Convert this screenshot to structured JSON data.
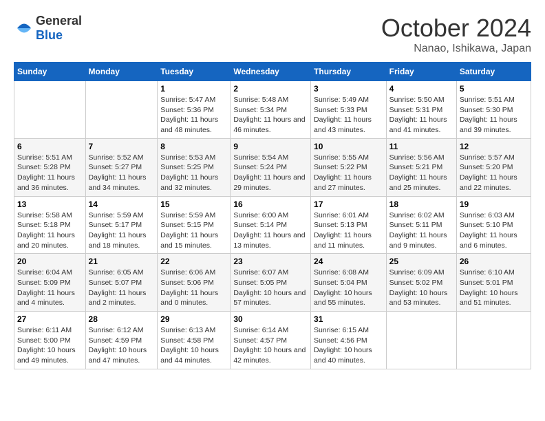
{
  "header": {
    "logo_general": "General",
    "logo_blue": "Blue",
    "month": "October 2024",
    "location": "Nanao, Ishikawa, Japan"
  },
  "columns": [
    "Sunday",
    "Monday",
    "Tuesday",
    "Wednesday",
    "Thursday",
    "Friday",
    "Saturday"
  ],
  "weeks": [
    [
      {
        "day": "",
        "sunrise": "",
        "sunset": "",
        "daylight": ""
      },
      {
        "day": "",
        "sunrise": "",
        "sunset": "",
        "daylight": ""
      },
      {
        "day": "1",
        "sunrise": "Sunrise: 5:47 AM",
        "sunset": "Sunset: 5:36 PM",
        "daylight": "Daylight: 11 hours and 48 minutes."
      },
      {
        "day": "2",
        "sunrise": "Sunrise: 5:48 AM",
        "sunset": "Sunset: 5:34 PM",
        "daylight": "Daylight: 11 hours and 46 minutes."
      },
      {
        "day": "3",
        "sunrise": "Sunrise: 5:49 AM",
        "sunset": "Sunset: 5:33 PM",
        "daylight": "Daylight: 11 hours and 43 minutes."
      },
      {
        "day": "4",
        "sunrise": "Sunrise: 5:50 AM",
        "sunset": "Sunset: 5:31 PM",
        "daylight": "Daylight: 11 hours and 41 minutes."
      },
      {
        "day": "5",
        "sunrise": "Sunrise: 5:51 AM",
        "sunset": "Sunset: 5:30 PM",
        "daylight": "Daylight: 11 hours and 39 minutes."
      }
    ],
    [
      {
        "day": "6",
        "sunrise": "Sunrise: 5:51 AM",
        "sunset": "Sunset: 5:28 PM",
        "daylight": "Daylight: 11 hours and 36 minutes."
      },
      {
        "day": "7",
        "sunrise": "Sunrise: 5:52 AM",
        "sunset": "Sunset: 5:27 PM",
        "daylight": "Daylight: 11 hours and 34 minutes."
      },
      {
        "day": "8",
        "sunrise": "Sunrise: 5:53 AM",
        "sunset": "Sunset: 5:25 PM",
        "daylight": "Daylight: 11 hours and 32 minutes."
      },
      {
        "day": "9",
        "sunrise": "Sunrise: 5:54 AM",
        "sunset": "Sunset: 5:24 PM",
        "daylight": "Daylight: 11 hours and 29 minutes."
      },
      {
        "day": "10",
        "sunrise": "Sunrise: 5:55 AM",
        "sunset": "Sunset: 5:22 PM",
        "daylight": "Daylight: 11 hours and 27 minutes."
      },
      {
        "day": "11",
        "sunrise": "Sunrise: 5:56 AM",
        "sunset": "Sunset: 5:21 PM",
        "daylight": "Daylight: 11 hours and 25 minutes."
      },
      {
        "day": "12",
        "sunrise": "Sunrise: 5:57 AM",
        "sunset": "Sunset: 5:20 PM",
        "daylight": "Daylight: 11 hours and 22 minutes."
      }
    ],
    [
      {
        "day": "13",
        "sunrise": "Sunrise: 5:58 AM",
        "sunset": "Sunset: 5:18 PM",
        "daylight": "Daylight: 11 hours and 20 minutes."
      },
      {
        "day": "14",
        "sunrise": "Sunrise: 5:59 AM",
        "sunset": "Sunset: 5:17 PM",
        "daylight": "Daylight: 11 hours and 18 minutes."
      },
      {
        "day": "15",
        "sunrise": "Sunrise: 5:59 AM",
        "sunset": "Sunset: 5:15 PM",
        "daylight": "Daylight: 11 hours and 15 minutes."
      },
      {
        "day": "16",
        "sunrise": "Sunrise: 6:00 AM",
        "sunset": "Sunset: 5:14 PM",
        "daylight": "Daylight: 11 hours and 13 minutes."
      },
      {
        "day": "17",
        "sunrise": "Sunrise: 6:01 AM",
        "sunset": "Sunset: 5:13 PM",
        "daylight": "Daylight: 11 hours and 11 minutes."
      },
      {
        "day": "18",
        "sunrise": "Sunrise: 6:02 AM",
        "sunset": "Sunset: 5:11 PM",
        "daylight": "Daylight: 11 hours and 9 minutes."
      },
      {
        "day": "19",
        "sunrise": "Sunrise: 6:03 AM",
        "sunset": "Sunset: 5:10 PM",
        "daylight": "Daylight: 11 hours and 6 minutes."
      }
    ],
    [
      {
        "day": "20",
        "sunrise": "Sunrise: 6:04 AM",
        "sunset": "Sunset: 5:09 PM",
        "daylight": "Daylight: 11 hours and 4 minutes."
      },
      {
        "day": "21",
        "sunrise": "Sunrise: 6:05 AM",
        "sunset": "Sunset: 5:07 PM",
        "daylight": "Daylight: 11 hours and 2 minutes."
      },
      {
        "day": "22",
        "sunrise": "Sunrise: 6:06 AM",
        "sunset": "Sunset: 5:06 PM",
        "daylight": "Daylight: 11 hours and 0 minutes."
      },
      {
        "day": "23",
        "sunrise": "Sunrise: 6:07 AM",
        "sunset": "Sunset: 5:05 PM",
        "daylight": "Daylight: 10 hours and 57 minutes."
      },
      {
        "day": "24",
        "sunrise": "Sunrise: 6:08 AM",
        "sunset": "Sunset: 5:04 PM",
        "daylight": "Daylight: 10 hours and 55 minutes."
      },
      {
        "day": "25",
        "sunrise": "Sunrise: 6:09 AM",
        "sunset": "Sunset: 5:02 PM",
        "daylight": "Daylight: 10 hours and 53 minutes."
      },
      {
        "day": "26",
        "sunrise": "Sunrise: 6:10 AM",
        "sunset": "Sunset: 5:01 PM",
        "daylight": "Daylight: 10 hours and 51 minutes."
      }
    ],
    [
      {
        "day": "27",
        "sunrise": "Sunrise: 6:11 AM",
        "sunset": "Sunset: 5:00 PM",
        "daylight": "Daylight: 10 hours and 49 minutes."
      },
      {
        "day": "28",
        "sunrise": "Sunrise: 6:12 AM",
        "sunset": "Sunset: 4:59 PM",
        "daylight": "Daylight: 10 hours and 47 minutes."
      },
      {
        "day": "29",
        "sunrise": "Sunrise: 6:13 AM",
        "sunset": "Sunset: 4:58 PM",
        "daylight": "Daylight: 10 hours and 44 minutes."
      },
      {
        "day": "30",
        "sunrise": "Sunrise: 6:14 AM",
        "sunset": "Sunset: 4:57 PM",
        "daylight": "Daylight: 10 hours and 42 minutes."
      },
      {
        "day": "31",
        "sunrise": "Sunrise: 6:15 AM",
        "sunset": "Sunset: 4:56 PM",
        "daylight": "Daylight: 10 hours and 40 minutes."
      },
      {
        "day": "",
        "sunrise": "",
        "sunset": "",
        "daylight": ""
      },
      {
        "day": "",
        "sunrise": "",
        "sunset": "",
        "daylight": ""
      }
    ]
  ]
}
